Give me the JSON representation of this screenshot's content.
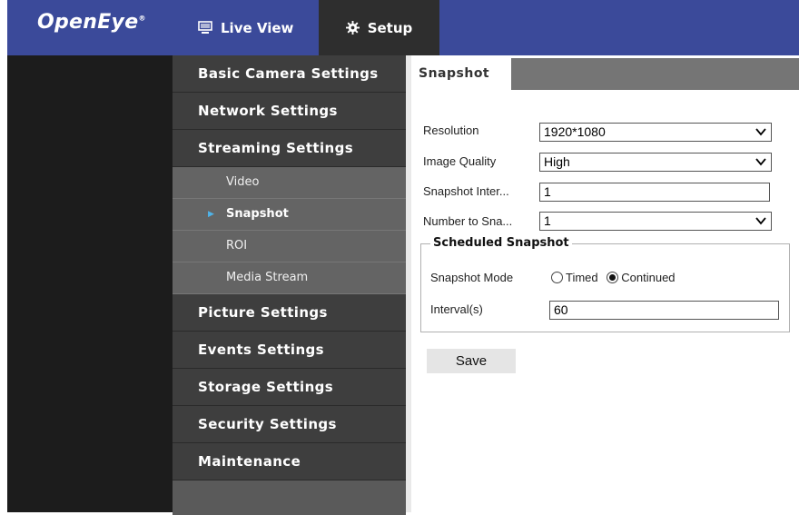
{
  "header": {
    "logo": "OpenEye",
    "logo_mark": "®",
    "tabs": [
      {
        "label": "Live View",
        "icon": "monitor-icon"
      },
      {
        "label": "Setup",
        "icon": "gear-icon"
      }
    ]
  },
  "sidebar": {
    "items": [
      {
        "label": "Basic Camera Settings"
      },
      {
        "label": "Network Settings"
      },
      {
        "label": "Streaming Settings"
      },
      {
        "label": "Picture Settings"
      },
      {
        "label": "Events Settings"
      },
      {
        "label": "Storage Settings"
      },
      {
        "label": "Security Settings"
      },
      {
        "label": "Maintenance"
      }
    ],
    "streaming_sub": [
      {
        "label": "Video"
      },
      {
        "label": "Snapshot"
      },
      {
        "label": "ROI"
      },
      {
        "label": "Media Stream"
      }
    ]
  },
  "content": {
    "tab_label": "Snapshot",
    "resolution": {
      "label": "Resolution",
      "value": "1920*1080"
    },
    "image_quality": {
      "label": "Image Quality",
      "value": "High"
    },
    "snapshot_interval": {
      "label": "Snapshot Inter...",
      "value": "1"
    },
    "number_to_snap": {
      "label": "Number to Sna...",
      "value": "1"
    },
    "scheduled": {
      "legend": "Scheduled Snapshot",
      "mode_label": "Snapshot Mode",
      "option_timed": "Timed",
      "option_continued": "Continued",
      "selected": "Continued",
      "interval_label": "Interval(s)",
      "interval_value": "60"
    },
    "save_label": "Save"
  },
  "colors": {
    "header_bg": "#3b4a9a",
    "setup_tab_bg": "#2e2e2e",
    "menu_bg": "#3e3e3e",
    "submenu_bg": "#646464",
    "tabbar_bg": "#757575",
    "active_arrow": "#4fb3e8"
  }
}
